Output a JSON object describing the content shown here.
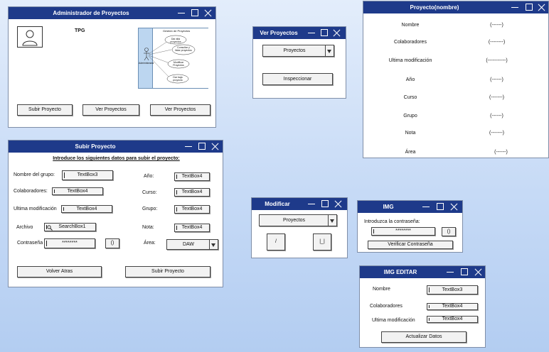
{
  "admin": {
    "title": "Administrador de Proyectos",
    "tpg": "TPG",
    "btn_subir": "Subir Proyecto",
    "btn_ver1": "Ver Proyectos",
    "btn_ver2": "Ver Proyectos",
    "diagram": {
      "system": "Gestión de Proyectos",
      "actor": "Administrador",
      "uc1": "Dar alta proyectos",
      "uc2": "Consultar y listar proyectos",
      "uc3": "Modificar Proyectos",
      "uc4": "Dar baja proyecto"
    }
  },
  "ver": {
    "title": "Ver Proyectos",
    "dropdown": "Proyectos",
    "btn_inspeccionar": "Inspeccionar"
  },
  "detalle": {
    "title": "Proyecto(nombre)",
    "rows": [
      {
        "label": "Nombre",
        "value": "(------)"
      },
      {
        "label": "Colaboradores",
        "value": "(--------)"
      },
      {
        "label": "Ultima modificación",
        "value": "(-----------)"
      },
      {
        "label": "Año",
        "value": "(------)"
      },
      {
        "label": "Curso",
        "value": "(-------)"
      },
      {
        "label": "Grupo",
        "value": "(------)"
      },
      {
        "label": "Nota",
        "value": "(-------)"
      },
      {
        "label": "Área",
        "value": "(------)"
      }
    ]
  },
  "subir": {
    "title": "Subir Proyecto",
    "heading": "Introduce los siguientes datos para subir el proyecto:",
    "lbl_nombre_grupo": "Nombre del grupo:",
    "lbl_colaboradores": "Colaboradores:",
    "lbl_ultima_mod": "Ultima modificación",
    "lbl_archivo": "Archivo",
    "lbl_contrasena": "Contraseña",
    "lbl_ano": "Año:",
    "lbl_curso": "Curso:",
    "lbl_grupo": "Grupo:",
    "lbl_nota": "Nota:",
    "lbl_area": "Área:",
    "tb_nombre": "TextBox3",
    "tb_colab": "TextBox4",
    "tb_ultima": "TextBox4",
    "search": "SearchBox1",
    "password": "********",
    "pw_toggle": "()",
    "tb_ano": "TextBox4",
    "tb_curso": "TextBox4",
    "tb_grupo": "TextBox4",
    "tb_nota": "TextBox4",
    "area_value": "DAW",
    "btn_volver": "Volver Atras",
    "btn_subir": "Subir Proyecto"
  },
  "modificar": {
    "title": "Modificar",
    "dropdown": "Proyectos",
    "btn_edit": "/",
    "btn_delete": "|_|"
  },
  "img": {
    "title": "IMG",
    "label": "Introduzca la contraseña:",
    "password": "********",
    "pw_toggle": "()",
    "btn_verificar": "Verificar Contraseña"
  },
  "imgeditar": {
    "title": "IMG EDITAR",
    "lbl_nombre": "Nombre",
    "lbl_colab": "Colaboradores",
    "lbl_ultima": "Ultima modificación",
    "tb_nombre": "TextBox3",
    "tb_colab": "TextBox4",
    "tb_ultima": "TextBox4",
    "btn_actualizar": "Actualizar Datos"
  },
  "colors": {
    "titlebar": "#1e3a8a",
    "background": "#c6daf6",
    "diagram_fill": "#bcd6f0"
  }
}
